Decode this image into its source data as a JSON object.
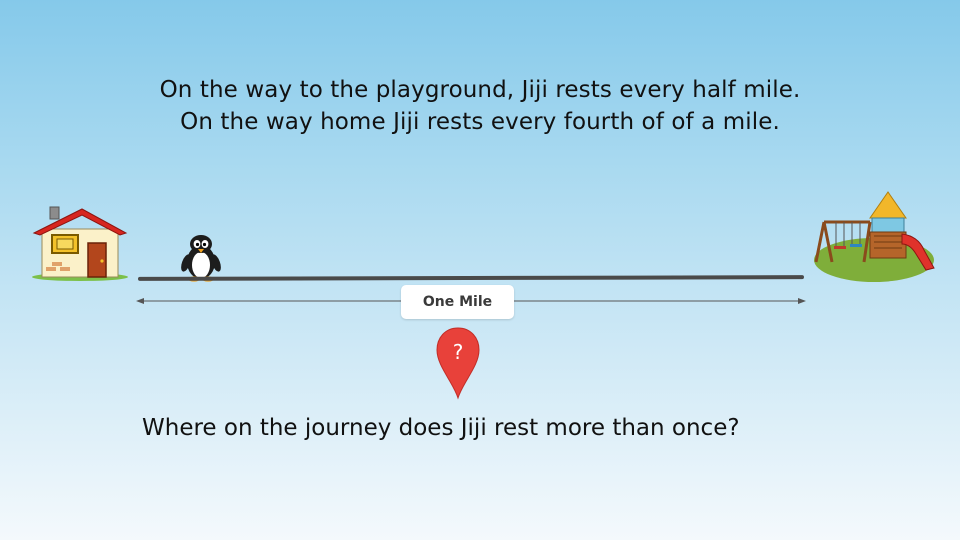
{
  "prompt": {
    "line1": "On the way to the playground, Jiji rests every half mile.",
    "line2": "On the way home Jiji rests every fourth of of a mile."
  },
  "diagram": {
    "start_icon": "house-icon",
    "end_icon": "playground-icon",
    "character_icon": "penguin-icon",
    "marker_icon": "map-pin-icon",
    "distance_label": "One Mile",
    "marker_symbol": "?"
  },
  "question": "Where on the journey does Jiji rest more than once?",
  "colors": {
    "background_top": "#85c9ea",
    "background_bottom": "#f4f9fc",
    "road": "#4a4a4a",
    "pin": "#e8413a"
  }
}
